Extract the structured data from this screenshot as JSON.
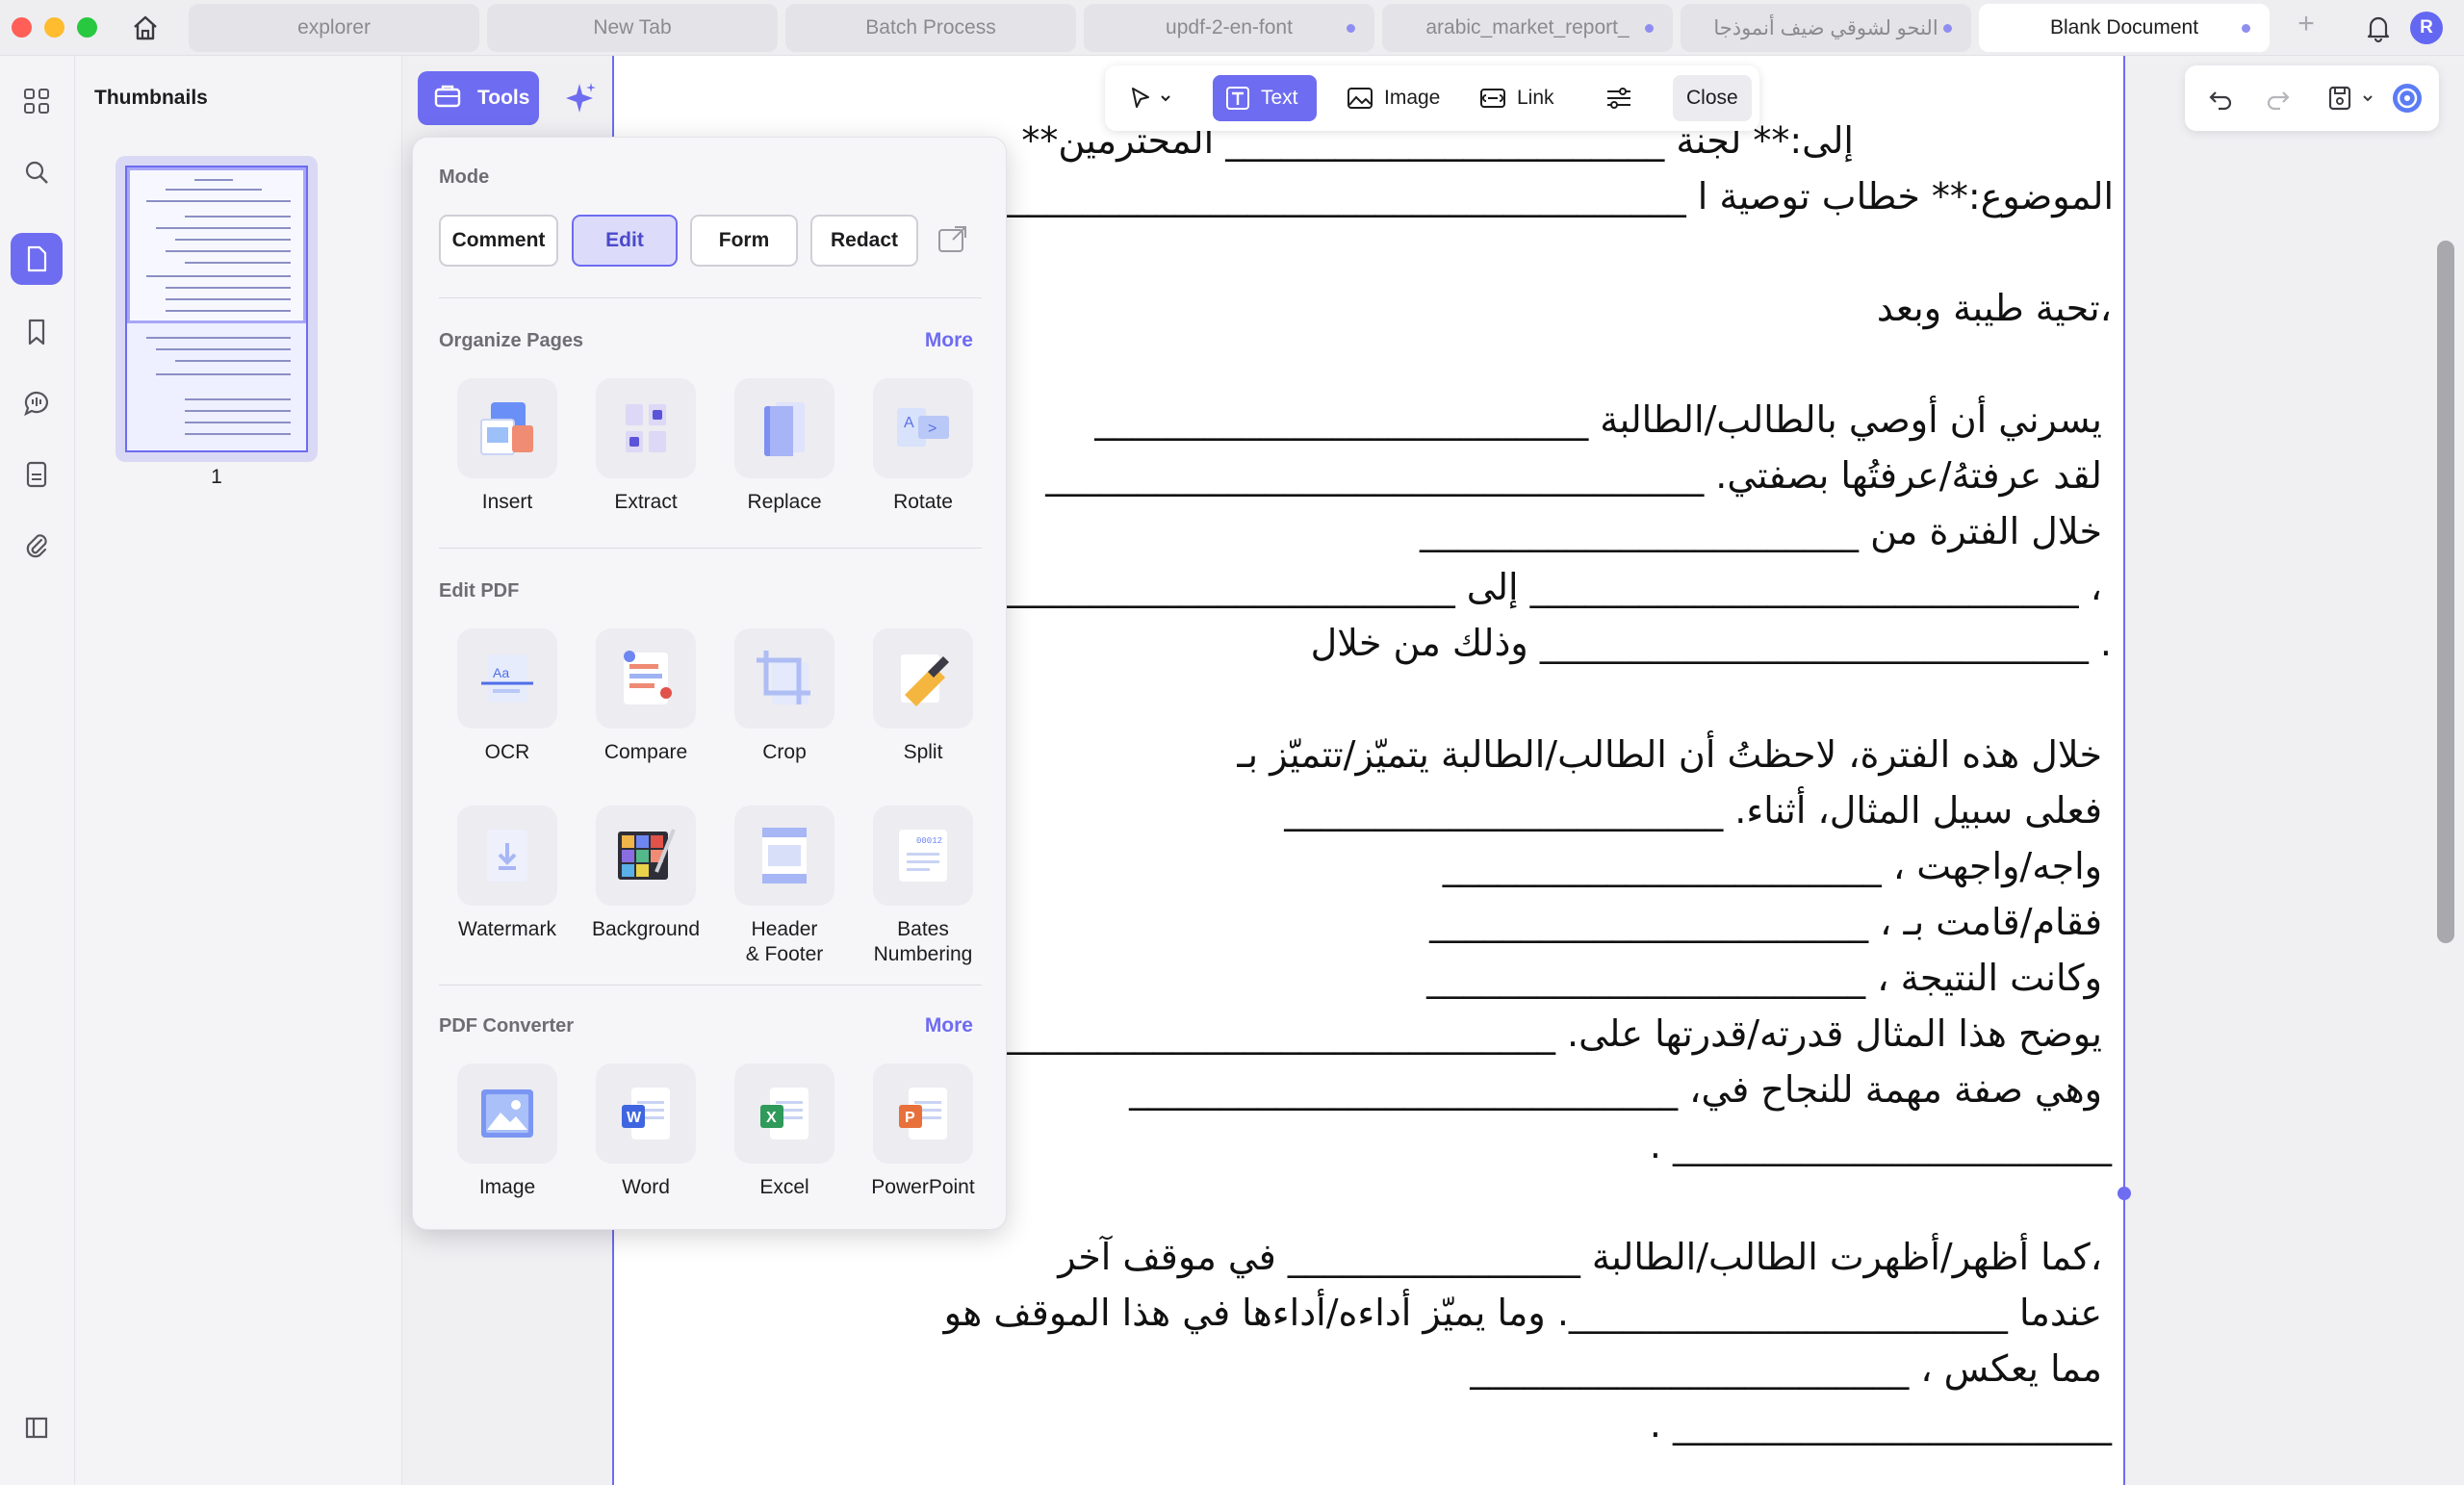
{
  "tabs": [
    {
      "label": "explorer",
      "dot": false
    },
    {
      "label": "New Tab",
      "dot": false
    },
    {
      "label": "Batch Process",
      "dot": false
    },
    {
      "label": "updf-2-en-font",
      "dot": true
    },
    {
      "label": "arabic_market_report_",
      "dot": true
    },
    {
      "label": "النحو لشوقي ضيف أنموذجا",
      "dot": true
    },
    {
      "label": "Blank Document",
      "dot": true
    }
  ],
  "user": {
    "avatar_initial": "R"
  },
  "thumbnails": {
    "title": "Thumbnails",
    "page_number": "1"
  },
  "tools_button": {
    "label": "Tools"
  },
  "edit_toolbar": {
    "text": "Text",
    "image": "Image",
    "link": "Link",
    "close": "Close"
  },
  "panel": {
    "mode_title": "Mode",
    "modes": [
      "Comment",
      "Edit",
      "Form",
      "Redact"
    ],
    "active_mode": "Edit",
    "organize_title": "Organize Pages",
    "organize_more": "More",
    "organize_tools": [
      "Insert",
      "Extract",
      "Replace",
      "Rotate"
    ],
    "edit_title": "Edit PDF",
    "edit_tools_row1": [
      "OCR",
      "Compare",
      "Crop",
      "Split"
    ],
    "edit_tools_row2": [
      "Watermark",
      "Background",
      "Header\n& Footer",
      "Bates\nNumbering"
    ],
    "converter_title": "PDF Converter",
    "converter_more": "More",
    "converter_tools": [
      "Image",
      "Word",
      "Excel",
      "PowerPoint"
    ]
  },
  "document_lines": [
    "إلى:** لجنة ________________________ المحترمين**",
    "الموضوع:** خطاب توصية ا ______________________________________",
    "،تحية طيبة وبعد",
    "يسرني أن أوصي بالطالب/الطالبة ___________________________",
    "لقد عرفتهُ/عرفتُها بصفتي. ____________________________________",
    "خلال الفترة من ________________________",
    "، ______________________________ إلى ______________________________",
    ". ______________________________ وذلك من خلال",
    "خلال هذه الفترة، لاحظتُ أن الطالب/الطالبة يتميّز/تتميّز بـ",
    "فعلى سبيل المثال، أثناء. ________________________",
    "واجه/واجهت ، ________________________",
    "فقام/قامت بـ ، ________________________",
    "وكانت النتيجة ، ________________________",
    "يوضح هذا المثال قدرته/قدرتها على. ______________________________",
    "وهي صفة مهمة للنجاح في، ______________________________",
    ". ________________________",
    "،كما أظهر/أظهرت الطالب/الطالبة ________________ في موقف آخر",
    "عندما ________________________. وما يميّز أداءه/أداءها في هذا الموقف هو",
    "مما يعكس ، ________________________",
    ". ________________________"
  ],
  "colors": {
    "accent": "#6e6cf0",
    "panel_bg": "#f6f6f9",
    "page_bg": "#ffffff"
  }
}
